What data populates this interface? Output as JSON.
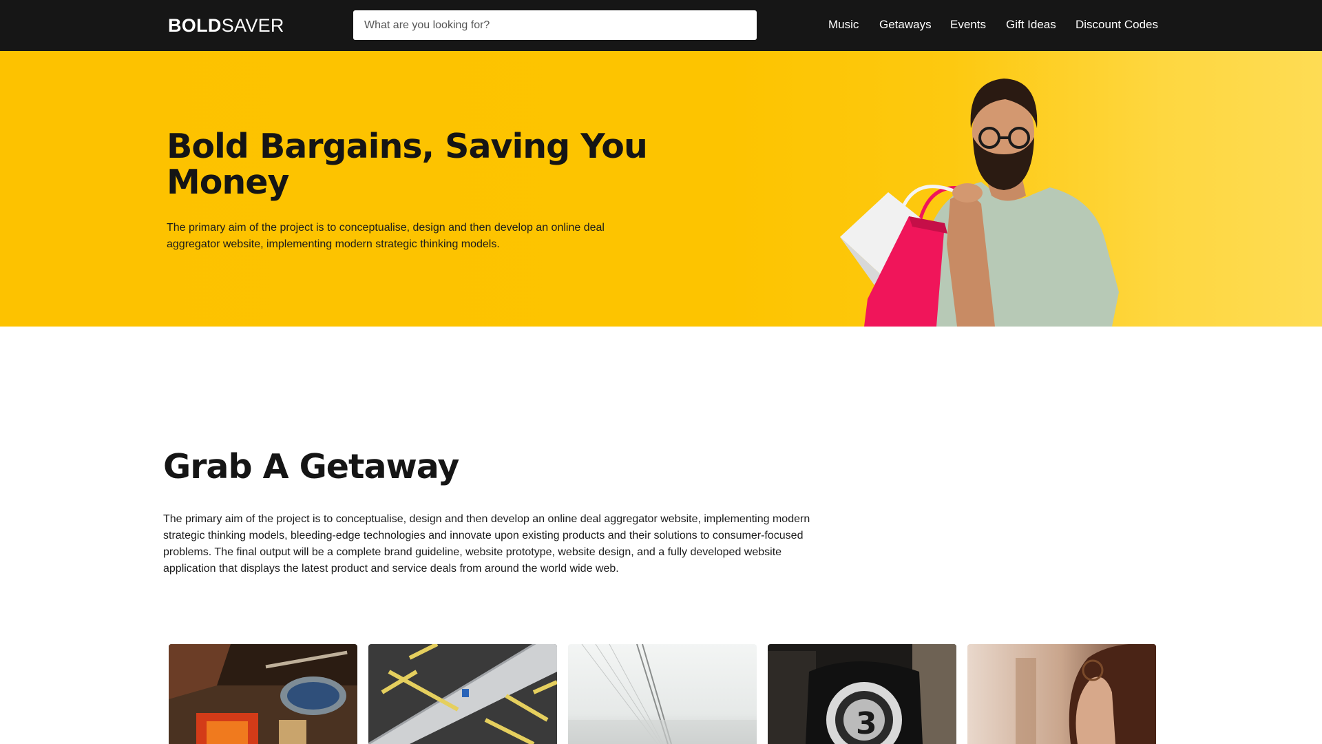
{
  "header": {
    "logo_bold": "BOLD",
    "logo_light": "SAVER",
    "search_placeholder": "What are you looking for?",
    "nav": [
      "Music",
      "Getaways",
      "Events",
      "Gift Ideas",
      "Discount Codes"
    ]
  },
  "hero": {
    "title": "Bold Bargains, Saving You Money",
    "description": "The primary aim of the project is to conceptualise, design and then develop an online deal aggregator website, implementing modern strategic thinking models.",
    "image": "man-with-shopping-bags"
  },
  "getaway": {
    "title": "Grab A Getaway",
    "description": "The primary aim of the project is to conceptualise, design and then develop an online deal aggregator website, implementing modern strategic thinking models, bleeding-edge technologies and innovate upon existing products and their solutions to consumer-focused problems. The final output will be a complete brand guideline, website prototype, website design, and a fully developed website application that displays the latest product and service deals from around the world wide web.",
    "cards": [
      {
        "image": "campfire-cooking"
      },
      {
        "image": "parking-lot-aerial"
      },
      {
        "image": "foggy-bridge-cables"
      },
      {
        "image": "film-countdown-pillow"
      },
      {
        "image": "woman-with-glasses"
      }
    ]
  },
  "colors": {
    "header_bg": "#161616",
    "hero_bg": "#fdc200",
    "text": "#151515",
    "bag_pink": "#f0155a",
    "tshirt": "#b7c9b6"
  }
}
